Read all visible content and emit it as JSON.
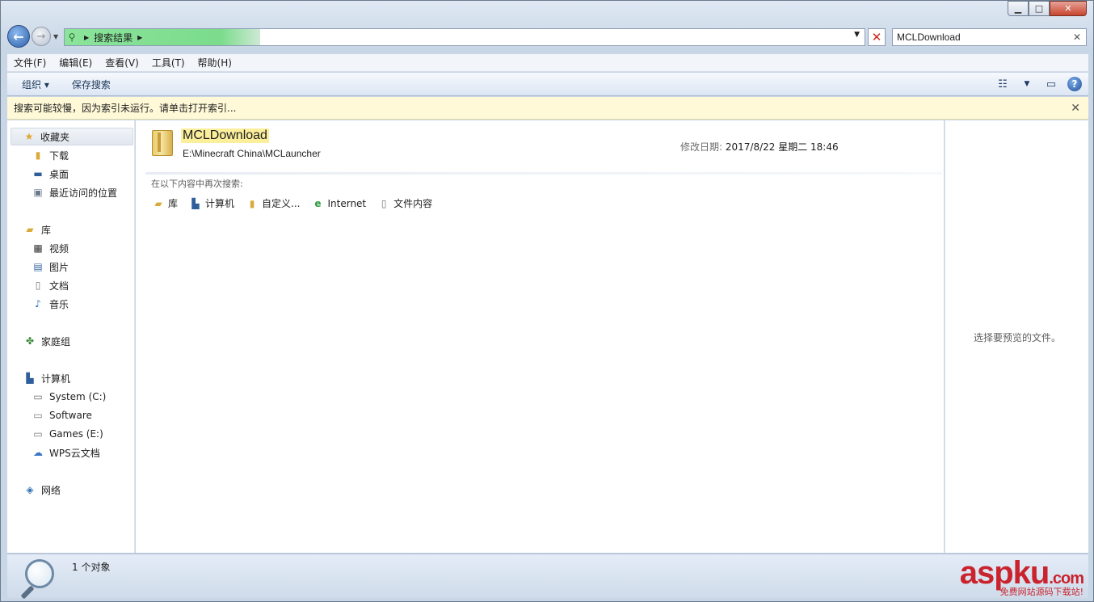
{
  "window": {
    "minimize": "▁",
    "maximize": "□",
    "close": "✕"
  },
  "address": {
    "crumb": "搜索结果"
  },
  "search": {
    "value": "MCLDownload"
  },
  "menu": [
    "文件(F)",
    "编辑(E)",
    "查看(V)",
    "工具(T)",
    "帮助(H)"
  ],
  "toolbar": {
    "organize": "组织 ▾",
    "save_search": "保存搜索"
  },
  "infobar": {
    "text": "搜索可能较慢，因为索引未运行。请单击打开索引..."
  },
  "nav": {
    "favorites": "收藏夹",
    "downloads": "下载",
    "desktop": "桌面",
    "recent": "最近访问的位置",
    "libraries": "库",
    "videos": "视频",
    "pictures": "图片",
    "documents": "文档",
    "music": "音乐",
    "homegroup": "家庭组",
    "computer": "计算机",
    "drive_c": "System (C:)",
    "drive_d": "Software",
    "drive_e": "Games (E:)",
    "wps": "WPS云文档",
    "network": "网络"
  },
  "result": {
    "name": "MCLDownload",
    "path": "E:\\Minecraft China\\MCLauncher",
    "date_label": "修改日期:",
    "date_value": "2017/8/22 星期二 18:46"
  },
  "search_again": {
    "label": "在以下内容中再次搜索:",
    "options": [
      "库",
      "计算机",
      "自定义...",
      "Internet",
      "文件内容"
    ]
  },
  "preview": {
    "text": "选择要预览的文件。"
  },
  "status": {
    "count": "1 个对象"
  },
  "watermark": {
    "brand": "aspku",
    "suffix": ".com",
    "sub": "免费网站源码下载站!"
  },
  "colors": {
    "accent": "#2b5fa8",
    "highlight": "#fbef9c",
    "info_bg": "#fff9d8",
    "watermark": "#c9232d"
  }
}
